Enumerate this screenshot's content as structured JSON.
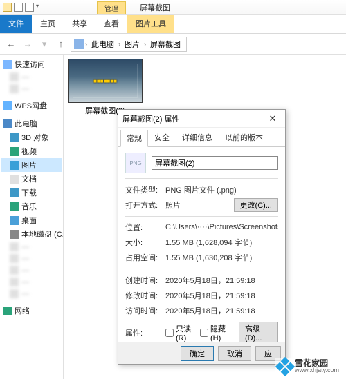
{
  "window": {
    "context_tab": "管理",
    "title": "屏幕截图"
  },
  "ribbon": {
    "file": "文件",
    "home": "主页",
    "share": "共享",
    "view": "查看",
    "tools": "图片工具"
  },
  "breadcrumb": {
    "root": "此电脑",
    "mid": "图片",
    "leaf": "屏幕截图"
  },
  "sidebar": {
    "quick": "快速访问",
    "blurred1": "—",
    "blurred2": "—",
    "wps": "WPS网盘",
    "thispc": "此电脑",
    "items": [
      "3D 对象",
      "视频",
      "图片",
      "文档",
      "下载",
      "音乐",
      "桌面",
      "本地磁盘 (C:)"
    ],
    "network": "网络"
  },
  "thumb": {
    "overlay": "■■■■■■■",
    "caption": "屏幕截图(2)"
  },
  "dialog": {
    "title": "屏幕截图(2) 属性",
    "tabs": {
      "general": "常规",
      "security": "安全",
      "details": "详细信息",
      "prev": "以前的版本"
    },
    "filename": "屏幕截图(2)",
    "labels": {
      "type": "文件类型:",
      "open_with": "打开方式:",
      "location": "位置:",
      "size": "大小:",
      "size_on_disk": "占用空间:",
      "created": "创建时间:",
      "modified": "修改时间:",
      "accessed": "访问时间:",
      "attrs": "属性:"
    },
    "values": {
      "type": "PNG 图片文件 (.png)",
      "open_with": "照片",
      "location": "C:\\Users\\····\\Pictures\\Screenshots",
      "size": "1.55 MB (1,628,094 字节)",
      "size_on_disk": "1.55 MB (1,630,208 字节)",
      "created": "2020年5月18日，21:59:18",
      "modified": "2020年5月18日，21:59:18",
      "accessed": "2020年5月18日，21:59:18"
    },
    "buttons": {
      "change": "更改(C)...",
      "advanced": "高级(D)...",
      "ok": "确定",
      "cancel": "取消",
      "apply": "应"
    },
    "checks": {
      "readonly": "只读(R)",
      "hidden": "隐藏(H)"
    }
  },
  "watermark": {
    "brand": "雪花家园",
    "url": "www.xhjaty.com"
  }
}
